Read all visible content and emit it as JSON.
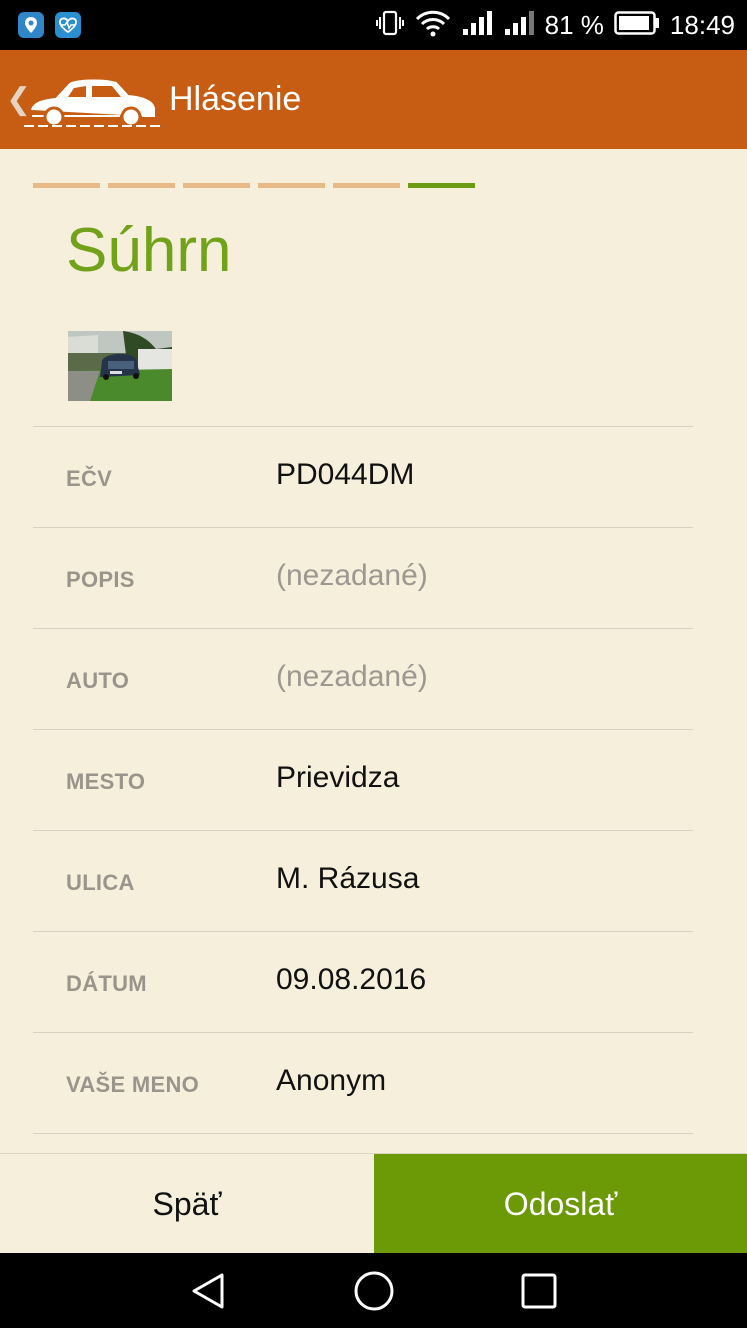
{
  "status_bar": {
    "battery_percent": "81 %",
    "time": "18:49",
    "icons": [
      "location-app-icon",
      "health-app-icon",
      "vibrate-icon",
      "wifi-icon",
      "signal-icon",
      "signal-icon",
      "battery-icon"
    ]
  },
  "app_bar": {
    "title": "Hlásenie",
    "back_icon": "chevron-left-icon",
    "logo": "car-logo-icon"
  },
  "progress": {
    "total_steps": 6,
    "current_step": 6,
    "done_color": "#e8b887",
    "active_color": "#6b9b12"
  },
  "summary": {
    "title": "Súhrn",
    "photo": "parked-car-photo",
    "rows": [
      {
        "label": "EČV",
        "value": "PD044DM",
        "empty": false
      },
      {
        "label": "POPIS",
        "value": "(nezadané)",
        "empty": true
      },
      {
        "label": "AUTO",
        "value": "(nezadané)",
        "empty": true
      },
      {
        "label": "MESTO",
        "value": "Prievidza",
        "empty": false
      },
      {
        "label": "ULICA",
        "value": "M. Rázusa",
        "empty": false
      },
      {
        "label": "DÁTUM",
        "value": "09.08.2016",
        "empty": false
      },
      {
        "label": "VAŠE MENO",
        "value": "Anonym",
        "empty": false
      }
    ]
  },
  "actions": {
    "back_label": "Späť",
    "send_label": "Odoslať"
  },
  "colors": {
    "accent_orange": "#c65d12",
    "accent_green": "#6c9a06",
    "background": "#f6efdc"
  },
  "nav_bar": {
    "icons": [
      "back-triangle-icon",
      "home-circle-icon",
      "recents-square-icon"
    ]
  }
}
